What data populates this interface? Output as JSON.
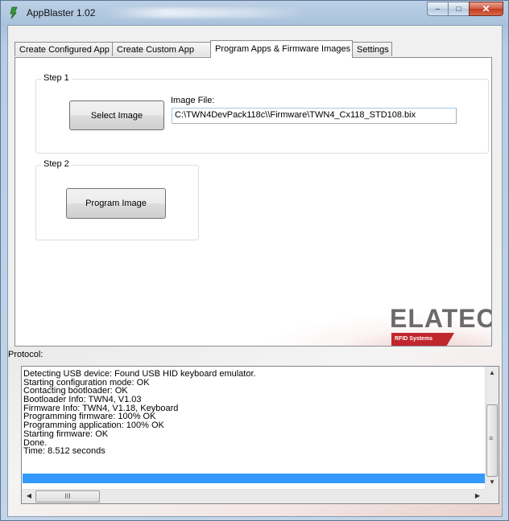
{
  "window": {
    "title": "AppBlaster 1.02",
    "controls": {
      "minimize": "–",
      "maximize": "□",
      "close": "✕"
    }
  },
  "tabs": [
    {
      "label": "Create Configured App",
      "active": false
    },
    {
      "label": "Create Custom App",
      "active": false
    },
    {
      "label": "Program Apps & Firmware Images",
      "active": true
    },
    {
      "label": "Settings",
      "active": false
    }
  ],
  "step1": {
    "title": "Step 1",
    "button": "Select Image",
    "image_file_label": "Image File:",
    "image_file_value": "C:\\TWN4DevPack118c\\\\Firmware\\TWN4_Cx118_STD108.bix"
  },
  "step2": {
    "title": "Step 2",
    "button": "Program Image"
  },
  "logo": {
    "name": "ELATEC",
    "tagline": "RFID Systems",
    "brand_color": "#c0272d"
  },
  "protocol": {
    "label": "Protocol:",
    "lines": [
      "Detecting USB device: Found USB HID keyboard emulator.",
      "Starting configuration mode: OK",
      "Contacting bootloader: OK",
      "Bootloader Info: TWN4, V1.03",
      "Firmware Info: TWN4, V1.18, Keyboard",
      "Programming firmware: 100% OK",
      "Programming application: 100% OK",
      "Starting firmware: OK",
      "Done.",
      "Time: 8.512 seconds"
    ],
    "selection_color": "#3399ff"
  },
  "scrollbar": {
    "up_icon": "▲",
    "down_icon": "▼",
    "left_icon": "◀",
    "right_icon": "▶",
    "grip_v": "≡",
    "grip_h": "III"
  }
}
